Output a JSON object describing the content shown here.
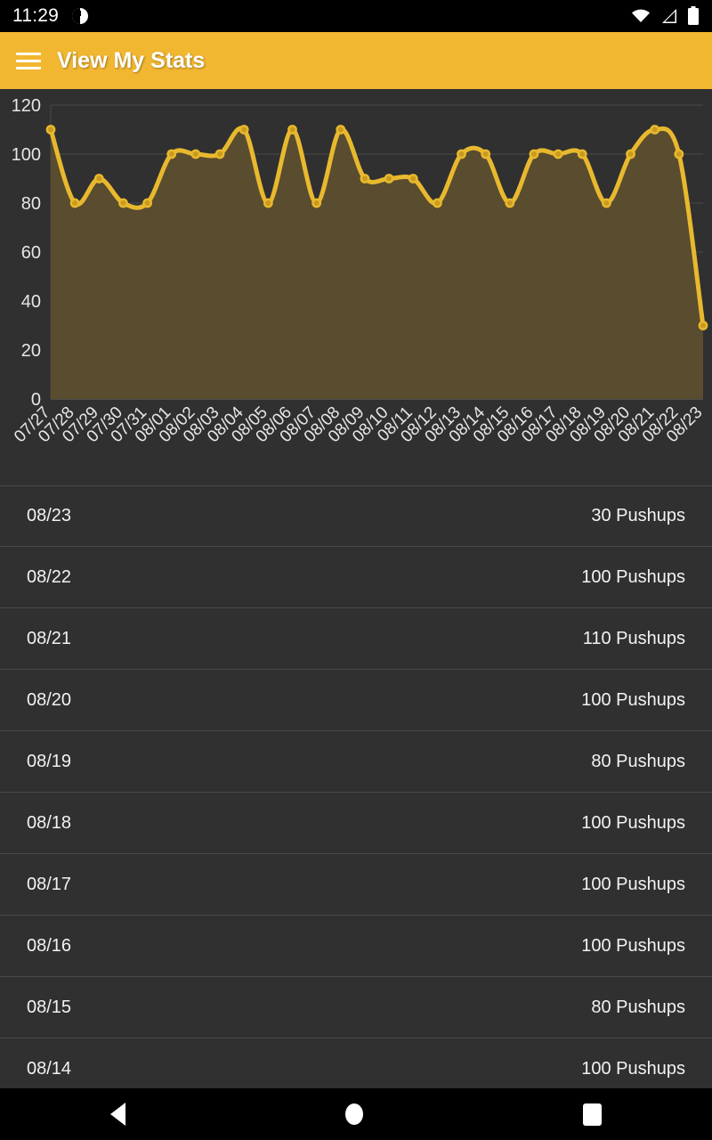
{
  "status_bar": {
    "time": "11:29",
    "icons": [
      "clock-icon",
      "wifi-icon",
      "cell-signal-icon",
      "battery-icon"
    ]
  },
  "app_bar": {
    "menu_icon": "hamburger-menu-icon",
    "title": "View My Stats",
    "background_color": "#F2B731"
  },
  "colors": {
    "accent": "#F2B731",
    "line": "#E8B92E",
    "area_fill": "#5A4C2E",
    "page_background": "#303030",
    "divider": "#4a4a4a",
    "text": "#f2f2f2"
  },
  "chart_data": {
    "type": "area",
    "title": "",
    "xlabel": "",
    "ylabel": "",
    "ylim": [
      0,
      120
    ],
    "yticks": [
      0,
      20,
      40,
      60,
      80,
      100,
      120
    ],
    "grid": true,
    "legend": "none",
    "line_color": "#E8B92E",
    "fill_color": "#5A4C2E",
    "categories": [
      "07/27",
      "07/28",
      "07/29",
      "07/30",
      "07/31",
      "08/01",
      "08/02",
      "08/03",
      "08/04",
      "08/05",
      "08/06",
      "08/07",
      "08/08",
      "08/09",
      "08/10",
      "08/11",
      "08/12",
      "08/13",
      "08/14",
      "08/15",
      "08/16",
      "08/17",
      "08/18",
      "08/19",
      "08/20",
      "08/21",
      "08/22",
      "08/23"
    ],
    "values": [
      110,
      80,
      90,
      80,
      80,
      100,
      100,
      100,
      110,
      80,
      110,
      80,
      110,
      90,
      90,
      90,
      80,
      100,
      100,
      80,
      100,
      100,
      100,
      80,
      100,
      110,
      100,
      30
    ]
  },
  "list": {
    "unit": "Pushups",
    "rows": [
      {
        "date": "08/23",
        "value": "30 Pushups"
      },
      {
        "date": "08/22",
        "value": "100 Pushups"
      },
      {
        "date": "08/21",
        "value": "110 Pushups"
      },
      {
        "date": "08/20",
        "value": "100 Pushups"
      },
      {
        "date": "08/19",
        "value": "80 Pushups"
      },
      {
        "date": "08/18",
        "value": "100 Pushups"
      },
      {
        "date": "08/17",
        "value": "100 Pushups"
      },
      {
        "date": "08/16",
        "value": "100 Pushups"
      },
      {
        "date": "08/15",
        "value": "80 Pushups"
      },
      {
        "date": "08/14",
        "value": "100 Pushups"
      }
    ]
  },
  "nav_bar": {
    "back_label": "Back",
    "home_label": "Home",
    "recents_label": "Recents"
  }
}
